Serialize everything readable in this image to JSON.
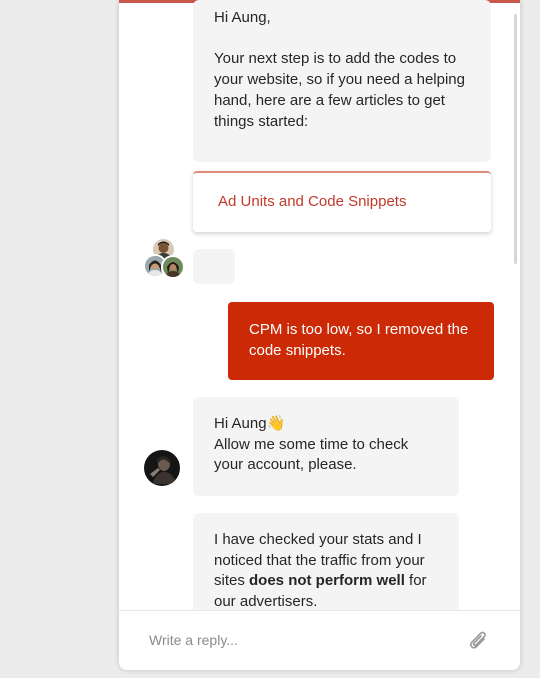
{
  "messages": {
    "m1": {
      "lines": [
        "Hi Aung,",
        "",
        "Your next step is to add the codes to",
        "your website, so if you need a helping",
        "hand, here are a few articles to get",
        "things started:"
      ]
    },
    "article": {
      "label": "Ad Units and Code Snippets"
    },
    "m2": {
      "lines": [
        "CPM is too low, so I removed the",
        "code snippets."
      ]
    },
    "m3": {
      "line1": "Hi Aung",
      "wave": "👋",
      "line2": "Allow me some time to check",
      "line3": "your account, please."
    },
    "m4": {
      "line1": "I have checked your stats and I",
      "line2": "noticed that the traffic from your",
      "line3_pre": "sites ",
      "line3_bold": "does not perform well",
      "line3_post": " for",
      "line4": "our advertisers."
    }
  },
  "composer": {
    "placeholder": "Write a reply..."
  },
  "icons": {
    "attach": "paperclip-icon",
    "team_avatars": "team-avatar-group",
    "agent_avatar": "agent-avatar"
  },
  "colors": {
    "accent": "#cc2a06",
    "link": "#c0392b",
    "incoming_bubble": "#f4f4f4"
  }
}
